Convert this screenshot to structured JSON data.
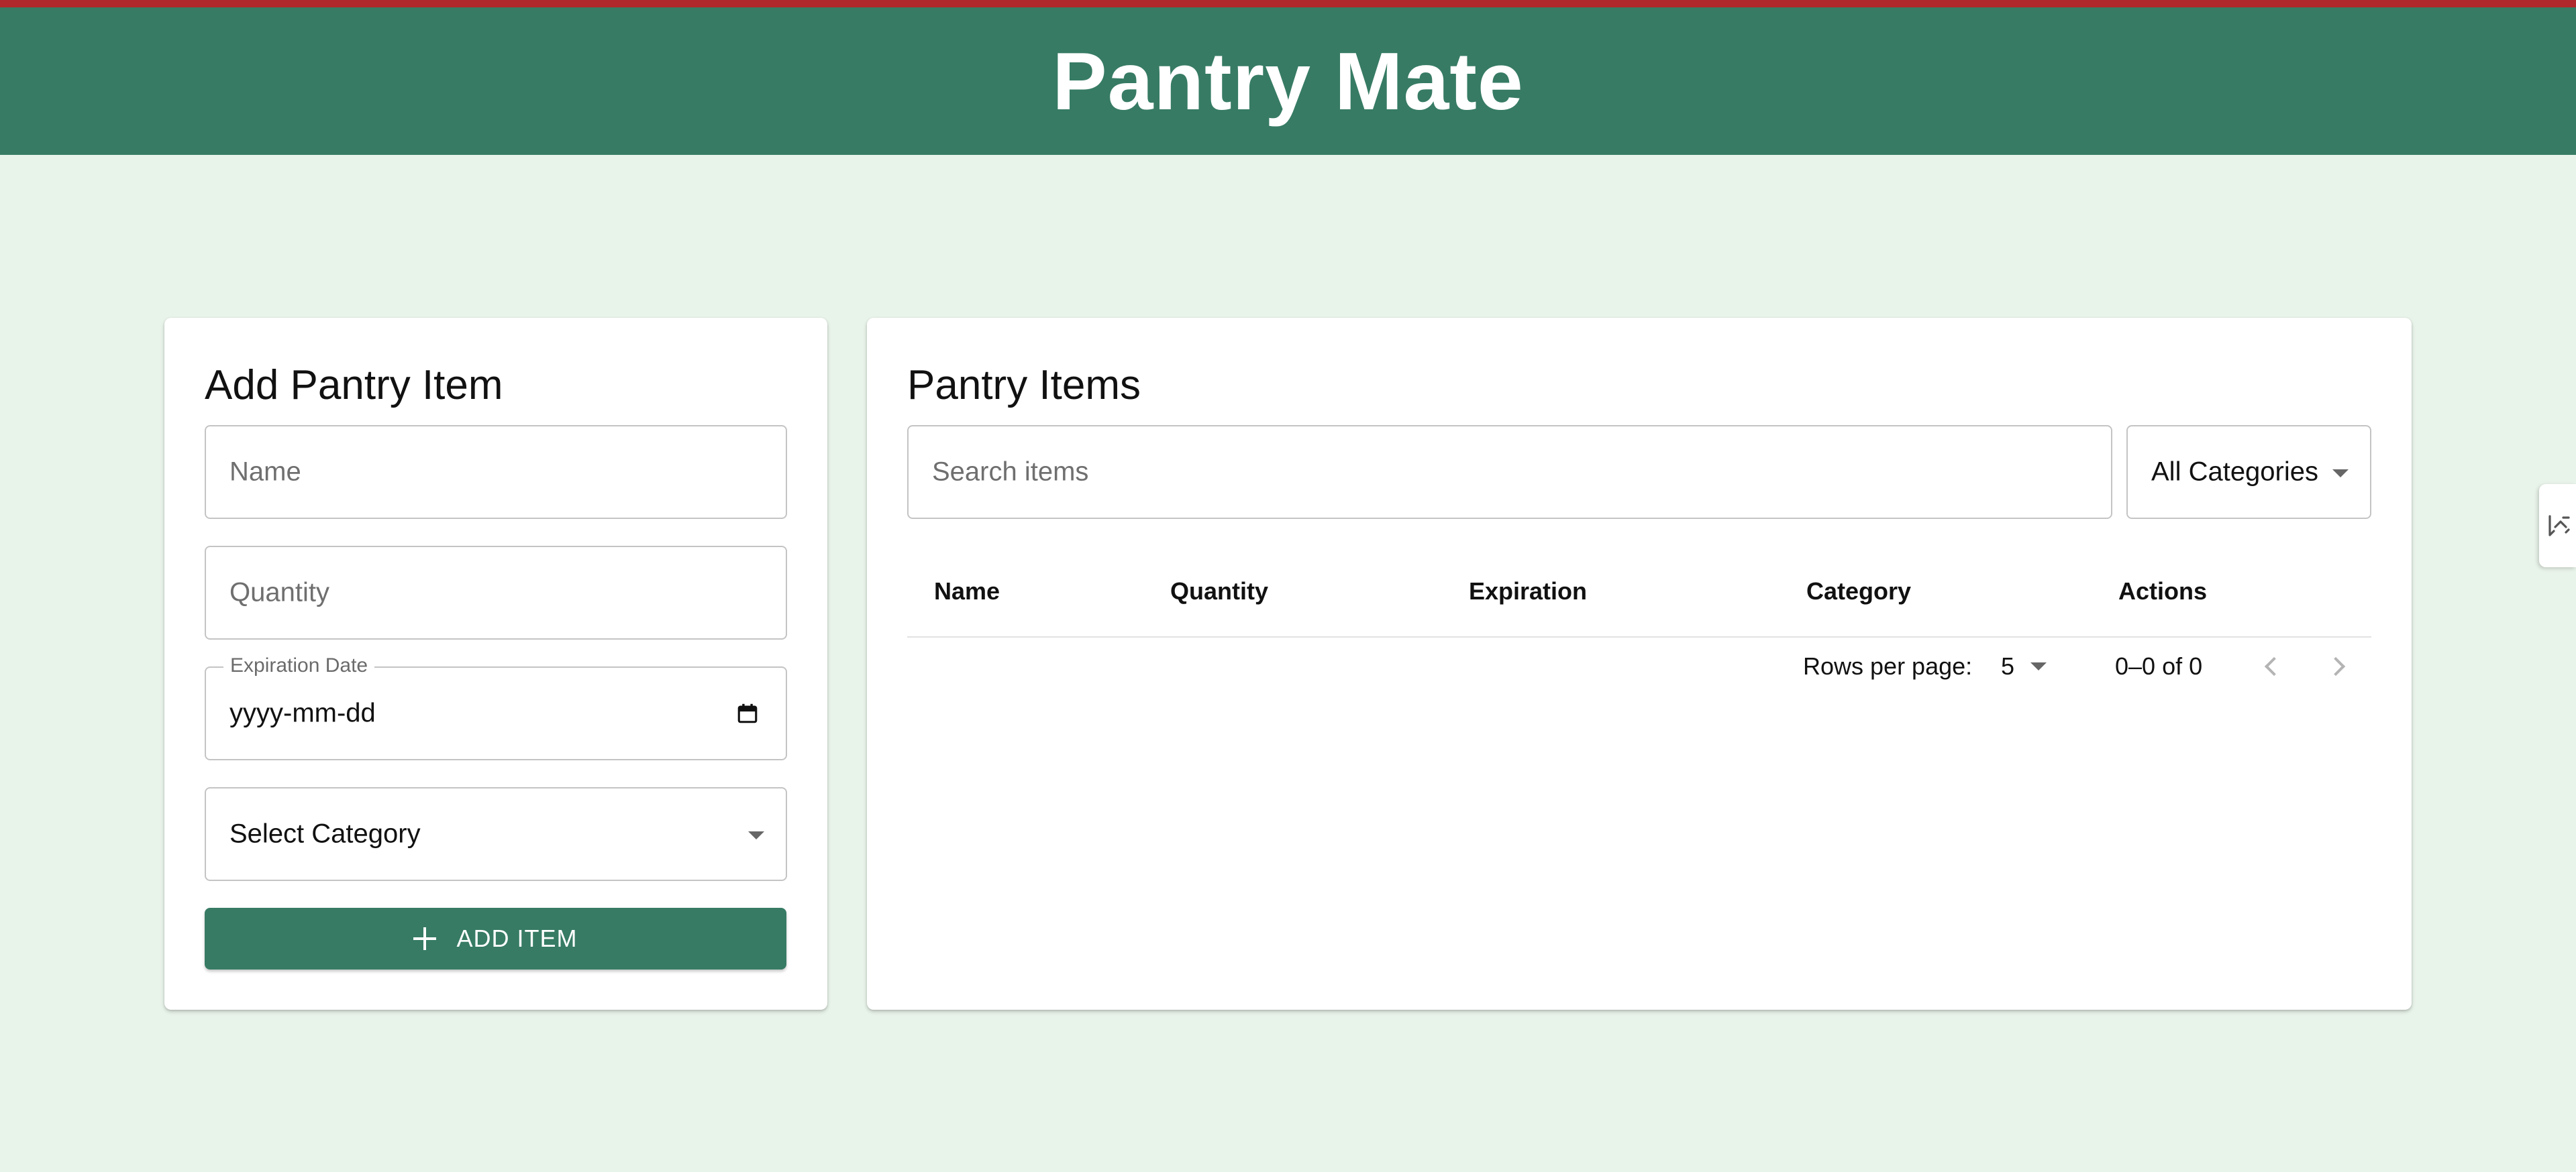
{
  "header": {
    "title": "Pantry Mate"
  },
  "add_form": {
    "title": "Add Pantry Item",
    "name_placeholder": "Name",
    "quantity_placeholder": "Quantity",
    "expiration_label": "Expiration Date",
    "expiration_value": "yyyy-mm-dd",
    "category_value": "Select Category",
    "add_button_label": "ADD ITEM"
  },
  "pantry_list": {
    "title": "Pantry Items",
    "search_placeholder": "Search items",
    "category_filter_value": "All Categories",
    "columns": [
      "Name",
      "Quantity",
      "Expiration",
      "Category",
      "Actions"
    ],
    "rows": [],
    "pagination": {
      "rows_per_page_label": "Rows per page:",
      "rows_per_page_value": "5",
      "range_text": "0–0 of 0"
    }
  },
  "icons": {
    "add": "plus-icon",
    "calendar": "calendar-icon",
    "dropdown": "caret-down-icon",
    "prev": "chevron-left-icon",
    "next": "chevron-right-icon",
    "side_widget": "sliders-icon"
  },
  "colors": {
    "brand_green": "#377b64",
    "top_accent": "#b0282b",
    "background": "#e8f3e9",
    "card": "#ffffff"
  }
}
